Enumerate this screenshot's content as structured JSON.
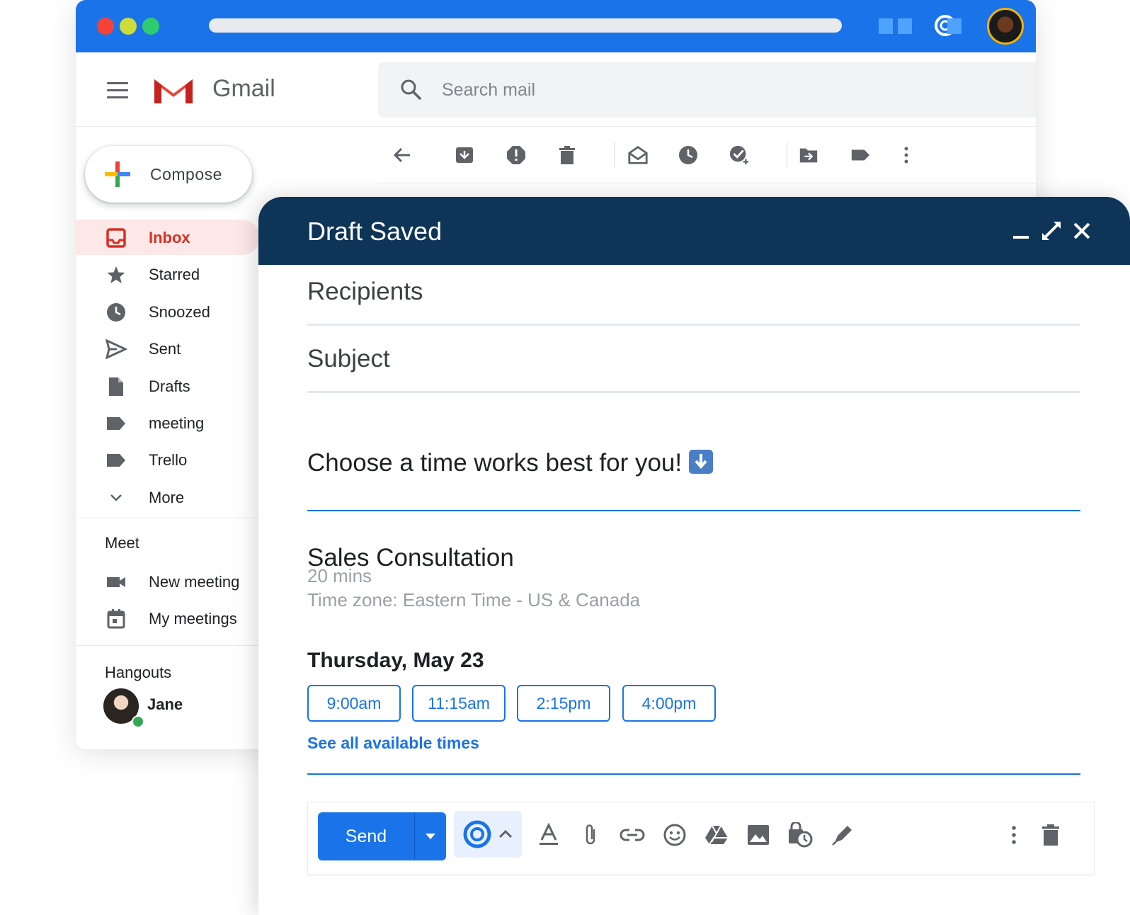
{
  "app": {
    "brand": "Gmail",
    "search_placeholder": "Search mail"
  },
  "sidebar": {
    "compose_label": "Compose",
    "items": [
      {
        "label": "Inbox",
        "icon": "inbox-icon",
        "active": true
      },
      {
        "label": "Starred",
        "icon": "star-icon"
      },
      {
        "label": "Snoozed",
        "icon": "clock-icon"
      },
      {
        "label": "Sent",
        "icon": "send-icon"
      },
      {
        "label": "Drafts",
        "icon": "draft-file-icon"
      },
      {
        "label": "meeting",
        "icon": "label-icon"
      },
      {
        "label": "Trello",
        "icon": "label-icon"
      },
      {
        "label": "More",
        "icon": "chevron-down-icon"
      }
    ],
    "meet_title": "Meet",
    "meet_items": [
      {
        "label": "New meeting",
        "icon": "video-camera-icon"
      },
      {
        "label": "My meetings",
        "icon": "calendar-icon"
      }
    ],
    "hangouts_title": "Hangouts",
    "hangouts_user": "Jane"
  },
  "compose": {
    "title": "Draft Saved",
    "recipients_placeholder": "Recipients",
    "subject_placeholder": "Subject",
    "body_text": "Choose a time works best for you!",
    "event": {
      "title": "Sales Consultation",
      "duration": "20 mins",
      "timezone": "Time zone: Eastern Time - US & Canada",
      "date": "Thursday, May 23",
      "times": [
        "9:00am",
        "11:15am",
        "2:15pm",
        "4:00pm"
      ],
      "see_all": "See all available times"
    },
    "send_label": "Send"
  },
  "colors": {
    "titlebar": "#1a73e8",
    "compose_header": "#0e3457",
    "accent": "#1a73e8",
    "inbox_active": "#d93025"
  }
}
